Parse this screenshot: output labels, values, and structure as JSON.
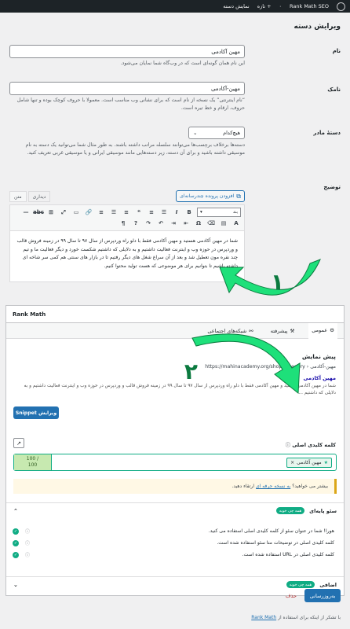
{
  "adminbar": {
    "site_name": "Rank Math SEO",
    "view_category": "نمایش دسته",
    "new": "تازه",
    "new_plus": "+",
    "update_count": "۰"
  },
  "page": {
    "title": "ویرایش دسته"
  },
  "fields": {
    "name_label": "نام",
    "name_value": "مهین آکادمی",
    "name_desc": "این نام همان گونه‌ای است که در وب‌گاه شما نمایان می‌شود.",
    "slug_label": "نامک",
    "slug_value": "مهین-آکادمی",
    "slug_desc": "“نام اینترنتی” یک نسخه از نام است که برای نشانی وب مناسب است. معمولا با حروف کوچک بوده و تنها شامل حروف، ارقام و خط تیره است.",
    "parent_label": "دستهٔ مادر",
    "parent_value": "هیچ‌کدام",
    "parent_desc": "دسته‌ها برخلاف برچسب‌ها می‌توانند سلسله مراتب داشته باشند. به طور مثال شما می‌توانید یک دسته به نام موسیقی داشته باشید و برای آن دسته، زیر دسته‌هایی مانند موسیقی ایرانی و یا موسیقی غربی تعریف کنید.",
    "description_label": "توضیح"
  },
  "editor": {
    "media_button": "افزودن پرونده چندرسانه‌ای",
    "tab_visual": "دیداری",
    "tab_text": "متن",
    "format_select": "بند",
    "content": "شما در مهین آکادمی هستید و مهین آکادمی فقط با دلو راه وردپرس از سال ۹۷ تا سال ۹۹ در زمینه فروش قالب و وردپرس در حوزه وب و اینترنت فعالیت داشتیم و به دلایلی که داشتیم شکست خورد و دیگر فعالیت ما و تیم چند نفره مون تعطیل شد و بعد از آن سراغ شغل های دیگر رفتیم تا در بازار های سنتی هم کمی سر شاخه ای داشته باشیم تا بتوانیم برای هر موضوعی که هست تولید محتوا کنیم."
  },
  "rankmath": {
    "box_title": "Rank Math",
    "tab_general": "عمومی",
    "tab_advanced": "پیشرفته",
    "tab_social": "شبکه‌های اجتماعی",
    "preview_title": "پیش نمایش",
    "serp_url": "https://mahinacademy.org/shop/category › مهین-آکادمی",
    "serp_title": "مهین آکادمی",
    "serp_desc": "شما در مهین آکادمی هستید و مهین آکادمی فقط با دلو راه وردپرس از سال ۹۷ تا سال ۹۹ در زمینه فروش قالب و وردپرس در حوزه وب و اینترنت فعالیت داشتیم و به دلایلی که داشتیم ...",
    "snippet_button": "ویرایش Snippet",
    "keyword_label": "کلمه کلیدی اصلی",
    "keyword_chip": "مهین آکادمی",
    "score_top": "100 /",
    "score_bottom": "100",
    "notice_text": "بیشتر می خواهید؟",
    "notice_link": "به نسخه حرفه ای",
    "notice_tail": "ارتقاء دهید.",
    "basic_seo_title": "سئو پایه‌ای",
    "basic_seo_badge": "همه چی خوبه",
    "checks": [
      "هورا! شما در عنوان سئو از کلمه کلیدی اصلی استفاده می کنید.",
      "کلمه کلیدی اصلی در توضیحات متا سئو استفاده شده است.",
      "کلمه کلیدی اصلی در URL استفاده شده است."
    ],
    "additional_title": "اضافی",
    "additional_badge": "همه چی خوبه"
  },
  "actions": {
    "update": "به‌روزرسانی",
    "delete": "حذف"
  },
  "footer": {
    "prefix": "با تشکر از اینکه برای استفاده از",
    "link": "Rank Math"
  },
  "colors": {
    "accent": "#2271b1",
    "success": "#10ac84",
    "arrow": "#1ee07a"
  }
}
